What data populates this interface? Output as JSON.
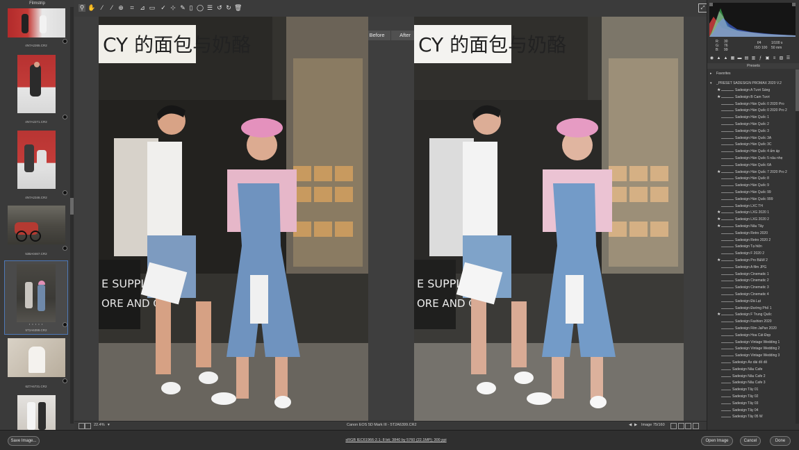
{
  "filmstrip": {
    "title": "Filmstrip",
    "items": [
      {
        "caption": "4N7A2265.CR2"
      },
      {
        "caption": "4N7A2271.CR2"
      },
      {
        "caption": "4N7A2346.CR2"
      },
      {
        "caption": "53BA0467.CR2"
      },
      {
        "caption": "5T2A6399.CR2",
        "selected": true,
        "stars": "• • • • •"
      },
      {
        "caption": "6Z7A6731.CR2"
      },
      {
        "caption": ""
      }
    ]
  },
  "toolbar": {
    "tools": [
      "zoom-icon",
      "hand-icon",
      "white-balance-icon",
      "color-sampler-icon",
      "target-adjust-icon",
      "crop-icon",
      "straighten-icon",
      "text-icon",
      "spot-removal-icon",
      "red-eye-icon",
      "brush-icon",
      "graduated-filter-icon",
      "radial-filter-icon",
      "preferences-icon",
      "rotate-ccw-icon",
      "rotate-cw-icon",
      "trash-icon"
    ],
    "fullscreen_icon": "fullscreen-icon"
  },
  "canvas": {
    "before_label": "Before",
    "after_label": "After"
  },
  "statusbar": {
    "zoom": "22.4%",
    "camera": "Canon EOS 5D Mark III  -  5T2A6399.CR2",
    "image_counter": "Image 75/160"
  },
  "info": {
    "r_label": "R:",
    "r_value": "30",
    "g_label": "G:",
    "g_value": "76",
    "b_label": "B:",
    "b_value": "99",
    "aperture": "f/4",
    "shutter": "1/100 s",
    "iso": "ISO 100",
    "focal": "50 mm"
  },
  "presets": {
    "header": "Presets",
    "favorites": "Favorites",
    "group": "_PRESET SADESIGN PROMAX 2020 V.2",
    "items": [
      {
        "label": "Sadesign A Tươi Sáng",
        "star": true
      },
      {
        "label": "Sadesign B  Cam Tươi",
        "star": true
      },
      {
        "label": "Sadesign Hàn Quốc 0 2020 Pro",
        "star": false
      },
      {
        "label": "Sadesign Hàn Quốc 0 2020 Pro 2",
        "star": false
      },
      {
        "label": "Sadesign Hàn Quốc 1",
        "star": false
      },
      {
        "label": "Sadesign Hàn Quốc 2",
        "star": false
      },
      {
        "label": "Sadesign Hàn Quốc 3",
        "star": false
      },
      {
        "label": "Sadesign Hàn Quốc 3A",
        "star": false
      },
      {
        "label": "Sadesign Hàn Quốc 3C",
        "star": false
      },
      {
        "label": "Sadesign Hàn Quốc 4 ấm áp",
        "star": false
      },
      {
        "label": "Sadesign Hàn Quốc 5 nâu nhẹ",
        "star": false
      },
      {
        "label": "Sadesign Hàn Quốc 6A",
        "star": false
      },
      {
        "label": "Sadesign Hàn Quốc 7 2020 Pro 2",
        "star": true
      },
      {
        "label": "Sadesign Hàn Quốc 8",
        "star": false
      },
      {
        "label": "Sadesign Hàn Quốc 9",
        "star": false
      },
      {
        "label": "Sadesign Hàn Quốc 99",
        "star": false
      },
      {
        "label": "Sadesign Hàn Quốc 999",
        "star": false
      },
      {
        "label": "Sadesign LXC  TH",
        "star": false
      },
      {
        "label": "Sadesign LXG 2020 1",
        "star": true
      },
      {
        "label": "Sadesign LXG 2020 2",
        "star": true
      },
      {
        "label": "Sadesign Nâu Tây",
        "star": true
      },
      {
        "label": "Sadesign Retro 2020",
        "star": false
      },
      {
        "label": "Sadesign Retro 2020 2",
        "star": false
      },
      {
        "label": "Sadesign Tạ hiện",
        "star": false
      },
      {
        "label": "Sadesign  F 2020 2",
        "star": false
      },
      {
        "label": "Sadesign  Pro B&W 2",
        "star": true
      },
      {
        "label": "Sadesign A film JPG",
        "star": false
      },
      {
        "label": "Sadesign Cinematic 1",
        "star": false
      },
      {
        "label": "Sadesign Cinematic 2",
        "star": false
      },
      {
        "label": "Sadesign Cinematic 3",
        "star": false
      },
      {
        "label": "Sadesign Cinematic 4",
        "star": false
      },
      {
        "label": "Sadesign Đà Lạt",
        "star": false
      },
      {
        "label": "Sadesign Đường Phố 1",
        "star": false
      },
      {
        "label": "Sadesign F Trung Quốc",
        "star": true
      },
      {
        "label": "Sadesign Fashion 2020",
        "star": false
      },
      {
        "label": "Sadesign Film JaPan 2020",
        "star": false
      },
      {
        "label": "Sadesign Hoa Cát Đẹp",
        "star": false
      },
      {
        "label": "Sadesign Vintage Wedding 1",
        "star": false
      },
      {
        "label": "Sadesign Vintage Wedding 2",
        "star": false
      },
      {
        "label": "Sadesign Vintage Wedding 3",
        "star": false
      },
      {
        "label": "Sadesign Áo dài đỏ đỏ",
        "star": false
      },
      {
        "label": "Sadesign Nâu Cafe",
        "star": false
      },
      {
        "label": "Sadesign Nâu Cafe 2",
        "star": false
      },
      {
        "label": "Sadesign Nâu Cafe 3",
        "star": false
      },
      {
        "label": "Sadesign Tây 01",
        "star": false
      },
      {
        "label": "Sadesign Tây 02",
        "star": false
      },
      {
        "label": "Sadesign Tây 03",
        "star": false
      },
      {
        "label": "Sadesign Tây 04",
        "star": false
      },
      {
        "label": "Sadesign Tây 05 W",
        "star": false
      }
    ]
  },
  "footer": {
    "save_label": "Save Image...",
    "workflow": "sRGB IEC61966-2.1; 8 bit; 3840 by 5760 (22.1MP); 300 ppi",
    "open_label": "Open Image",
    "cancel_label": "Cancel",
    "done_label": "Done"
  },
  "colors": {
    "accent": "#4f79b8",
    "panel": "#343434",
    "canvas": "#3e3e3e"
  }
}
